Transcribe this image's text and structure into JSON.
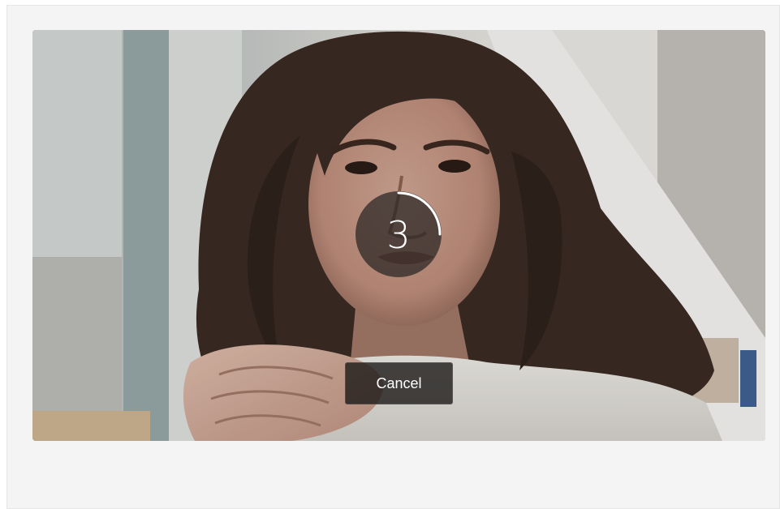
{
  "capture": {
    "countdown_value": "3",
    "countdown_progress": 0.25,
    "cancel_label": "Cancel"
  },
  "photo": {
    "subject": "camera-preview"
  },
  "colors": {
    "dialog_bg": "#f4f4f4",
    "overlay_dark": "#28241f",
    "text": "#ffffff"
  }
}
